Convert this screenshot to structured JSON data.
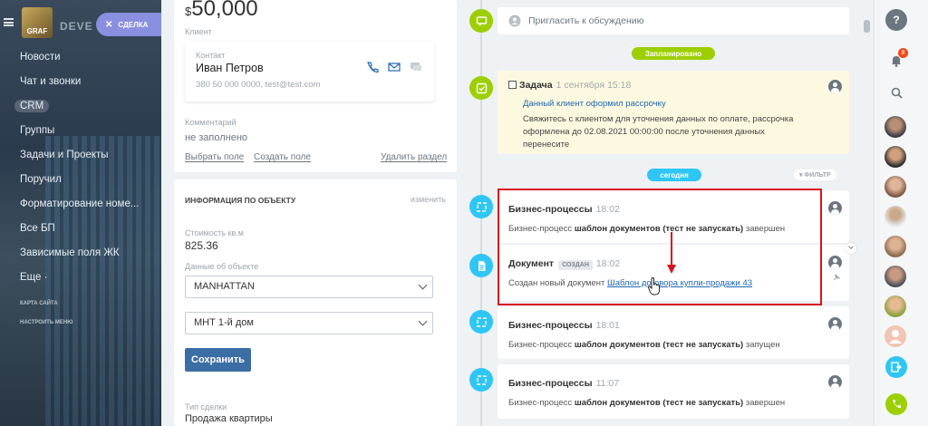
{
  "sidebar": {
    "logo_text": "GRAF",
    "brand_text": "DEVE",
    "deal_chip": "СДЕЛКА",
    "items": [
      {
        "label": "Новости"
      },
      {
        "label": "Чат и звонки"
      },
      {
        "label": "CRM"
      },
      {
        "label": "Группы"
      },
      {
        "label": "Задачи и Проекты"
      },
      {
        "label": "Поручил"
      },
      {
        "label": "Форматирование номе..."
      },
      {
        "label": "Все БП"
      },
      {
        "label": "Зависимые поля ЖК"
      },
      {
        "label": "Еще ·"
      }
    ],
    "small_links": [
      "КАРТА САЙТА",
      "НАСТРОИТЬ МЕНЮ"
    ]
  },
  "deal": {
    "price_currency": "$",
    "price_value": "50,000",
    "client_label": "Клиент",
    "contact_label": "Контакт",
    "contact_name": "Иван Петров",
    "contact_meta": "380 50 000 0000, test@test.com",
    "comment_label": "Комментарий",
    "comment_value": "не заполнено",
    "select_field": "Выбрать поле",
    "create_field": "Создать поле",
    "delete_section": "Удалить раздел",
    "object_section_title": "ИНФОРМАЦИЯ ПО ОБЪЕКТУ",
    "object_section_edit": "изменить",
    "cost_label": "Стоимость кв.м",
    "cost_value": "825.36",
    "object_data_label": "Данные об объекте",
    "select1": "MANHATTAN",
    "select2": "МНТ 1-й дом",
    "save_button": "Сохранить",
    "deal_type_label": "Тип сделки",
    "deal_type_value": "Продажа квартиры"
  },
  "timeline": {
    "invite": "Пригласить к обсуждению",
    "planned_pill": "Запланировано",
    "task": {
      "title": "Задача",
      "date": "1 сентября 15:18",
      "link": "Данный клиент оформил рассрочку",
      "body1": "Свяжитесь с клиентом для уточнения данных по оплате, рассрочка",
      "body2": "оформлена до 02.08.2021 00:00:00 после уточнения данных",
      "body3": "перенесите"
    },
    "today_pill": "сегодня",
    "filter": "ФИЛЬТР",
    "items": [
      {
        "title": "Бизнес-процессы",
        "time": "18:02",
        "prefix": "Бизнес-процесс",
        "bold": "шаблон документов (тест не запускать)",
        "suffix": "завершен"
      },
      {
        "title": "Документ",
        "badge": "СОЗДАН",
        "time": "18:02",
        "prefix": "Создан новый документ",
        "link": "Шаблон договора купли-продажи 43"
      },
      {
        "title": "Бизнес-процессы",
        "time": "18:01",
        "prefix": "Бизнес-процесс",
        "bold": "шаблон документов (тест не запускать)",
        "suffix": "запущен"
      },
      {
        "title": "Бизнес-процессы",
        "time": "11:07",
        "prefix": "Бизнес-процесс",
        "bold": "шаблон документов (тест не запускать)",
        "suffix": "завершен"
      }
    ]
  },
  "rail": {
    "help": "?",
    "notif_count": "8"
  },
  "colors": {
    "accent_green": "#9dcf00",
    "accent_blue": "#2fc6f6",
    "highlight_red": "#d8141e",
    "save_blue": "#3b6ea5"
  }
}
